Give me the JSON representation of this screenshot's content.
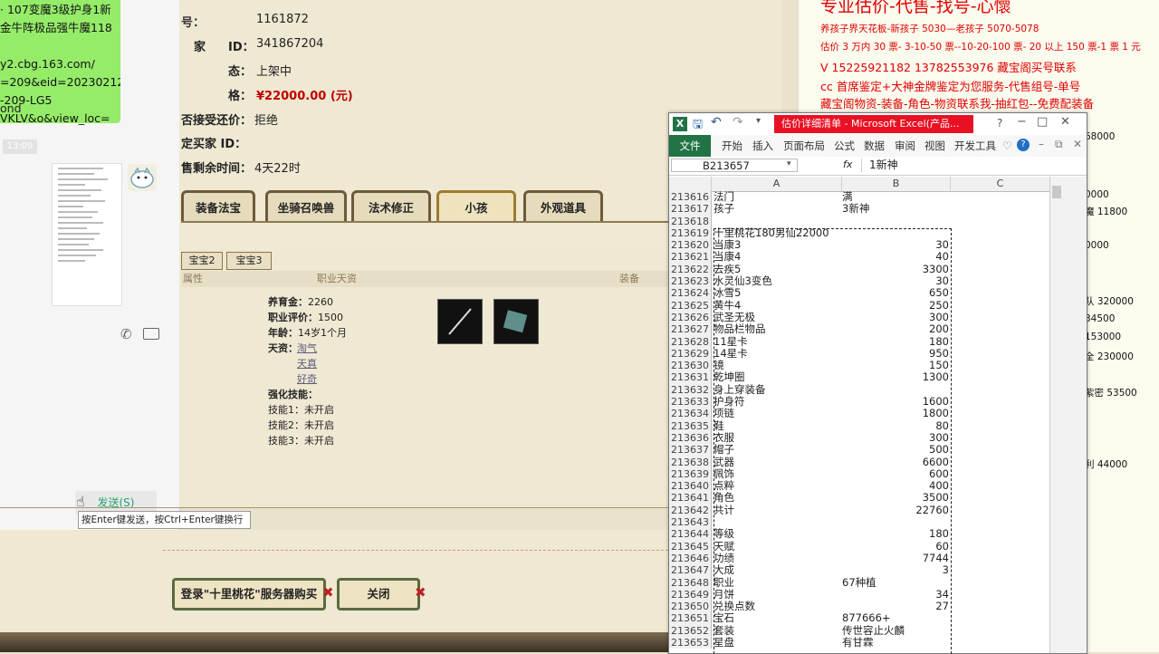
{
  "chat": {
    "lines": [
      "· 107变魔3级护身1新",
      "金牛阵极品强牛魔118",
      "",
      "y2.cbg.163.com/",
      "=209&eid=20230212",
      "-209-LG5",
      "VKLV&o&view_loc=",
      "ond"
    ],
    "timestamp": "13:09",
    "send_button": "发送(S)",
    "tooltip": "按Enter键发送，按Ctrl+Enter键换行"
  },
  "game": {
    "fields": [
      {
        "key": "号：",
        "value": "1161872"
      },
      {
        "key": "ID：",
        "value": "341867204"
      },
      {
        "key": "态：",
        "value": "上架中"
      },
      {
        "key": "格：",
        "value": "¥22000.00 (元)"
      }
    ],
    "field_left_labels": [
      "家",
      "否接受还价：",
      "定买家 ID：",
      "售剩余时间："
    ],
    "counter_offer": "拒绝",
    "time_left": "4天22时",
    "tabs": [
      "装备法宝",
      "坐骑召唤兽",
      "法术修正",
      "小孩",
      "外观道具"
    ],
    "active_tab": "小孩",
    "subtabs": [
      "宝宝2",
      "宝宝3"
    ],
    "col_headers": [
      "属性",
      "职业天资",
      "装备"
    ],
    "child": {
      "lines": [
        {
          "label": "养育金：",
          "value": "2260"
        },
        {
          "label": "职业评价：",
          "value": "1500"
        },
        {
          "label": "年龄：",
          "value": "14岁1个月"
        }
      ],
      "talent_label": "天资：",
      "talents": [
        "淘气",
        "天真",
        "好奇"
      ],
      "skills_label": "强化技能：",
      "skills": [
        "技能1：未开启",
        "技能2：未开启",
        "技能3：未开启"
      ]
    },
    "login_button": "登录\"十里桃花\"服务器购买",
    "close_button": "关闭"
  },
  "ad_panel": {
    "title": "专业估价-代售-找号-心懷",
    "lines": [
      "养孩子界天花板-新孩子 5030—老孩子 5070-5078",
      "估价 3 万内 30 票- 3-10-50 票--10-20-100 票- 20 以上 150 票-1 票 1 元",
      "V 15225921182    13782553976    藏宝阁买号联系",
      "cc 首席鉴定+大神金牌鉴定为您服务-代售组号-单号",
      "藏宝阁物资-装备-角色-物资联系我-抽红包--免费配装备"
    ],
    "right_values": [
      "68000",
      "魔 11800",
      "0000",
      "0000",
      "队 320000",
      "34500",
      "153000",
      "全 230000",
      "紫密 53500",
      "利 44000"
    ]
  },
  "excel": {
    "title": "估价详细清单 - Microsoft Excel(产品...",
    "file_tab": "文件",
    "menu": [
      "开始",
      "插入",
      "页面布局",
      "公式",
      "数据",
      "审阅",
      "视图",
      "开发工具"
    ],
    "name_box": "B213657",
    "fx": "fx",
    "formula": "1新神",
    "columns": [
      "A",
      "B",
      "C"
    ],
    "rows": [
      {
        "n": "213616",
        "a": "法门",
        "b": "满"
      },
      {
        "n": "213617",
        "a": "孩子",
        "b": "3新神"
      },
      {
        "n": "213618",
        "a": "",
        "b": ""
      },
      {
        "n": "213619",
        "a": "十里桃花180男仙22000",
        "b": ""
      },
      {
        "n": "213620",
        "a": "当康3",
        "b": "30",
        "num": true
      },
      {
        "n": "213621",
        "a": "当康4",
        "b": "40",
        "num": true
      },
      {
        "n": "213622",
        "a": "去疾5",
        "b": "3300",
        "num": true
      },
      {
        "n": "213623",
        "a": "水灵仙3变色",
        "b": "30",
        "num": true
      },
      {
        "n": "213624",
        "a": "冰雪5",
        "b": "650",
        "num": true
      },
      {
        "n": "213625",
        "a": "黄牛4",
        "b": "250",
        "num": true
      },
      {
        "n": "213626",
        "a": "武圣无极",
        "b": "300",
        "num": true
      },
      {
        "n": "213627",
        "a": "物品栏物品",
        "b": "200",
        "num": true
      },
      {
        "n": "213628",
        "a": "11星卡",
        "b": "180",
        "num": true
      },
      {
        "n": "213629",
        "a": "14星卡",
        "b": "950",
        "num": true
      },
      {
        "n": "213630",
        "a": "镜",
        "b": "150",
        "num": true
      },
      {
        "n": "213631",
        "a": "乾坤圈",
        "b": "1300",
        "num": true
      },
      {
        "n": "213632",
        "a": "身上穿装备",
        "b": ""
      },
      {
        "n": "213633",
        "a": "护身符",
        "b": "1600",
        "num": true
      },
      {
        "n": "213634",
        "a": "项链",
        "b": "1800",
        "num": true
      },
      {
        "n": "213635",
        "a": "鞋",
        "b": "80",
        "num": true
      },
      {
        "n": "213636",
        "a": "衣服",
        "b": "300",
        "num": true
      },
      {
        "n": "213637",
        "a": "帽子",
        "b": "500",
        "num": true
      },
      {
        "n": "213638",
        "a": "武器",
        "b": "6600",
        "num": true
      },
      {
        "n": "213639",
        "a": "佩饰",
        "b": "600",
        "num": true
      },
      {
        "n": "213640",
        "a": "点粹",
        "b": "400",
        "num": true
      },
      {
        "n": "213641",
        "a": "角色",
        "b": "3500",
        "num": true
      },
      {
        "n": "213642",
        "a": "共计",
        "b": "22760",
        "num": true
      },
      {
        "n": "213643",
        "a": "",
        "b": ""
      },
      {
        "n": "213644",
        "a": "等级",
        "b": "180",
        "num": true
      },
      {
        "n": "213645",
        "a": "天赋",
        "b": "60",
        "num": true
      },
      {
        "n": "213646",
        "a": "功绩",
        "b": "7744",
        "num": true
      },
      {
        "n": "213647",
        "a": "大成",
        "b": "3",
        "num": true
      },
      {
        "n": "213648",
        "a": "职业",
        "b": "67种植"
      },
      {
        "n": "213649",
        "a": "月饼",
        "b": "34",
        "num": true
      },
      {
        "n": "213650",
        "a": "兑换点数",
        "b": "27",
        "num": true
      },
      {
        "n": "213651",
        "a": "宝石",
        "b": "877666+"
      },
      {
        "n": "213652",
        "a": "套装",
        "b": "传世容止火麟"
      },
      {
        "n": "213653",
        "a": "星盘",
        "b": "有甘霖"
      }
    ]
  }
}
